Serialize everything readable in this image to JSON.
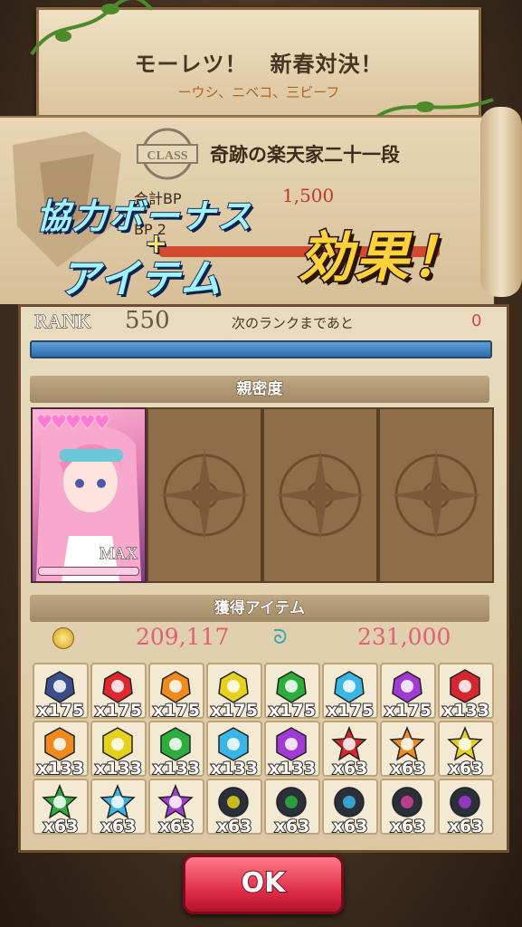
{
  "banner": {
    "title": "モーレツ！　新春対決！",
    "subtitle": "ーウシ、ニベコ、三ビーフ"
  },
  "class": {
    "stamp": "CLASS",
    "name": "奇跡の楽天家二十一段",
    "bp_label": "合計BP",
    "bp_value": "1,500",
    "bp2_label": "BP 2"
  },
  "promo": {
    "line1": "協力ボーナス",
    "plus": "+",
    "line2": "アイテム",
    "effect": "効果！"
  },
  "rank": {
    "label": "RANK",
    "value": "550",
    "next_label": "次のランクまであと",
    "next_value": "0"
  },
  "affinity": {
    "header": "親密度",
    "hearts": "♥♥♥♥♥",
    "max_label": "MAX"
  },
  "items": {
    "header": "獲得アイテム",
    "coin_value": "209,117",
    "swirl_value": "231,000",
    "grid": [
      {
        "count": "x175",
        "color": "#3a4f8a",
        "shape": "gem"
      },
      {
        "count": "x175",
        "color": "#e0262e",
        "shape": "gem"
      },
      {
        "count": "x175",
        "color": "#f08a1c",
        "shape": "gem"
      },
      {
        "count": "x175",
        "color": "#e6d21a",
        "shape": "gem"
      },
      {
        "count": "x175",
        "color": "#2cae3c",
        "shape": "gem"
      },
      {
        "count": "x175",
        "color": "#38b6e6",
        "shape": "gem"
      },
      {
        "count": "x175",
        "color": "#a23ad6",
        "shape": "gem"
      },
      {
        "count": "x133",
        "color": "#d8262e",
        "shape": "hex"
      },
      {
        "count": "x133",
        "color": "#f08a1c",
        "shape": "hex"
      },
      {
        "count": "x133",
        "color": "#e6d21a",
        "shape": "hex"
      },
      {
        "count": "x133",
        "color": "#2cae3c",
        "shape": "hex"
      },
      {
        "count": "x133",
        "color": "#38b6e6",
        "shape": "hex"
      },
      {
        "count": "x133",
        "color": "#a23ad6",
        "shape": "hex"
      },
      {
        "count": "x63",
        "color": "#d8262e",
        "shape": "star"
      },
      {
        "count": "x63",
        "color": "#f08a1c",
        "shape": "star"
      },
      {
        "count": "x63",
        "color": "#e6d21a",
        "shape": "star"
      },
      {
        "count": "x63",
        "color": "#2cae3c",
        "shape": "star"
      },
      {
        "count": "x63",
        "color": "#38b6e6",
        "shape": "star"
      },
      {
        "count": "x63",
        "color": "#a23ad6",
        "shape": "star"
      },
      {
        "count": "x63",
        "color": "#e6d21a",
        "shape": "orb"
      },
      {
        "count": "x63",
        "color": "#2cae3c",
        "shape": "orb"
      },
      {
        "count": "x63",
        "color": "#38b6e6",
        "shape": "orb"
      },
      {
        "count": "x63",
        "color": "#d8409a",
        "shape": "orb"
      },
      {
        "count": "x63",
        "color": "#a23ad6",
        "shape": "orb"
      }
    ]
  },
  "ok_label": "OK"
}
